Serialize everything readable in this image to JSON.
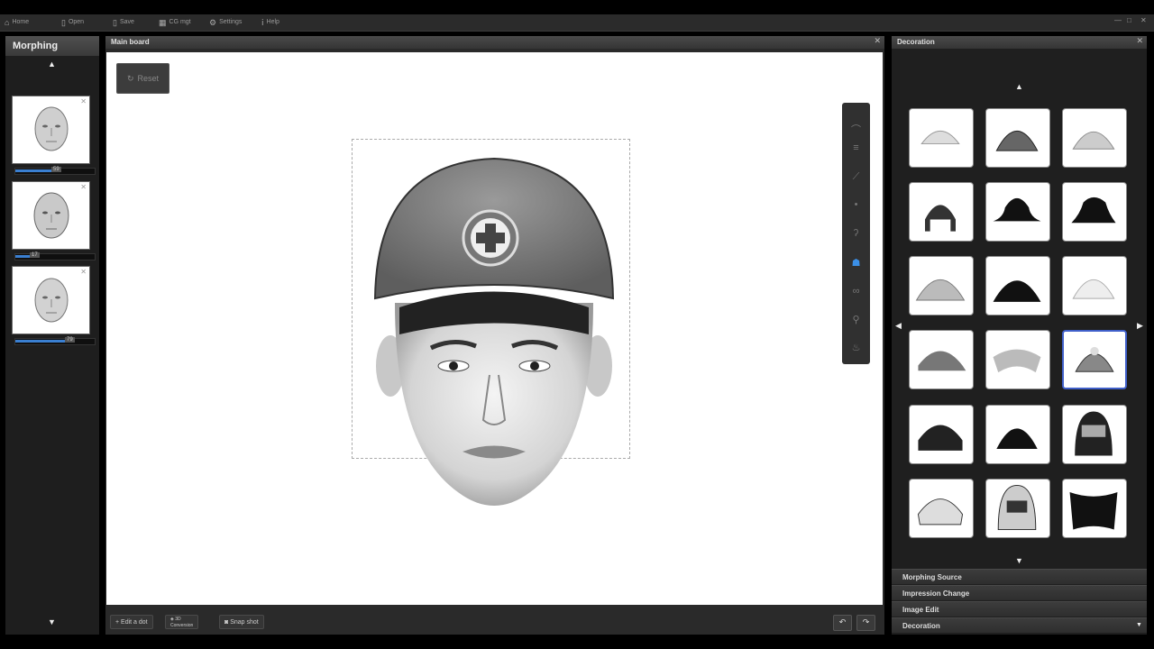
{
  "menu": {
    "home": "Home",
    "open": "Open",
    "save": "Save",
    "cg": "CG mgt",
    "settings": "Settings",
    "help": "Help"
  },
  "morphing": {
    "title": "Morphing",
    "items": [
      {
        "value": "59",
        "fill": 0.45
      },
      {
        "value": "17",
        "fill": 0.2
      },
      {
        "value": "79",
        "fill": 0.62
      }
    ]
  },
  "main": {
    "title": "Main board",
    "reset_label": "Reset",
    "edit_dot_label": "Edit a dot",
    "conversion_label_1": "3D",
    "conversion_label_2": "Conversion",
    "snapshot_label": "Snap shot"
  },
  "decoration": {
    "title": "Decoration",
    "items": [
      {
        "name": "bucket-hat"
      },
      {
        "name": "knit-beanie-striped"
      },
      {
        "name": "knit-beanie-white"
      },
      {
        "name": "earflap-hat"
      },
      {
        "name": "black-bowler-hat"
      },
      {
        "name": "black-fedora"
      },
      {
        "name": "fur-beanie"
      },
      {
        "name": "black-fur-hat"
      },
      {
        "name": "white-cap"
      },
      {
        "name": "baseball-cap"
      },
      {
        "name": "headband"
      },
      {
        "name": "safety-helmet"
      },
      {
        "name": "bicycle-helmet"
      },
      {
        "name": "black-helmet"
      },
      {
        "name": "full-face-helmet"
      },
      {
        "name": "white-bike-helmet"
      },
      {
        "name": "racing-helmet"
      },
      {
        "name": "face-mask"
      }
    ],
    "selected_index": 11
  },
  "accordion": [
    "Morphing Source",
    "Impression Change",
    "Image Edit",
    "Decoration"
  ],
  "colors": {
    "accent": "#3b8fe6",
    "selected_border": "#3f5fc9",
    "panel_bg": "#222222"
  }
}
